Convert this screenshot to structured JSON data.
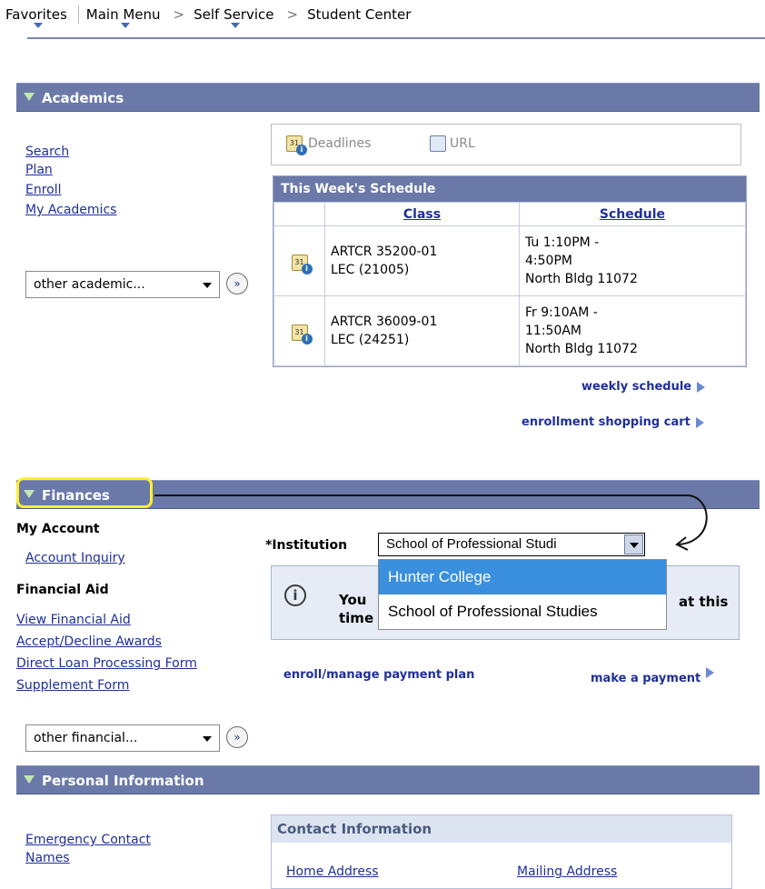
{
  "breadcrumb": {
    "favorites": "Favorites",
    "main_menu": "Main Menu",
    "self_service": "Self Service",
    "student_center": "Student Center",
    "sep": ">"
  },
  "academics": {
    "title": "Academics",
    "links": [
      "Search",
      "Plan",
      "Enroll",
      "My Academics"
    ],
    "other_dropdown": "other academic...",
    "go_icon": "double-chevron-right",
    "tabs": {
      "deadlines": "Deadlines",
      "url": "URL"
    },
    "schedule": {
      "title": "This Week's Schedule",
      "col_class": "Class",
      "col_schedule": "Schedule",
      "rows": [
        {
          "class_line1": "ARTCR 35200-01",
          "class_line2": "LEC (21005)",
          "sched_line1": "Tu 1:10PM -",
          "sched_line2": "4:50PM",
          "sched_line3": "North Bldg 11072"
        },
        {
          "class_line1": "ARTCR 36009-01",
          "class_line2": "LEC (24251)",
          "sched_line1": "Fr 9:10AM -",
          "sched_line2": "11:50AM",
          "sched_line3": "North Bldg 11072"
        }
      ]
    },
    "weekly_schedule": "weekly schedule",
    "shopping_cart": "enrollment shopping cart"
  },
  "finances": {
    "title": "Finances",
    "my_account": "My Account",
    "account_inquiry": "Account Inquiry",
    "financial_aid": "Financial Aid",
    "aid_links": [
      "View Financial Aid",
      "Accept/Decline Awards",
      "Direct Loan Processing Form",
      "Supplement Form"
    ],
    "other_dropdown": "other financial...",
    "institution_label": "*Institution",
    "institution_value": "School of Professional Studi",
    "options": [
      "Hunter College",
      "School of Professional Studies"
    ],
    "info_you": "You",
    "info_time": "time",
    "info_at_this": "at this",
    "enroll_plan": "enroll/manage payment plan",
    "make_payment": "make a payment"
  },
  "personal": {
    "title": "Personal Information",
    "links": [
      "Emergency Contact",
      "Names"
    ],
    "contact_title": "Contact Information",
    "home_address": "Home Address",
    "mailing_address": "Mailing Address"
  },
  "colors": {
    "section_header": "#6b79a8",
    "link": "#1f2f9a",
    "selected_option": "#3a8fde",
    "highlight": "#ffef2e"
  }
}
